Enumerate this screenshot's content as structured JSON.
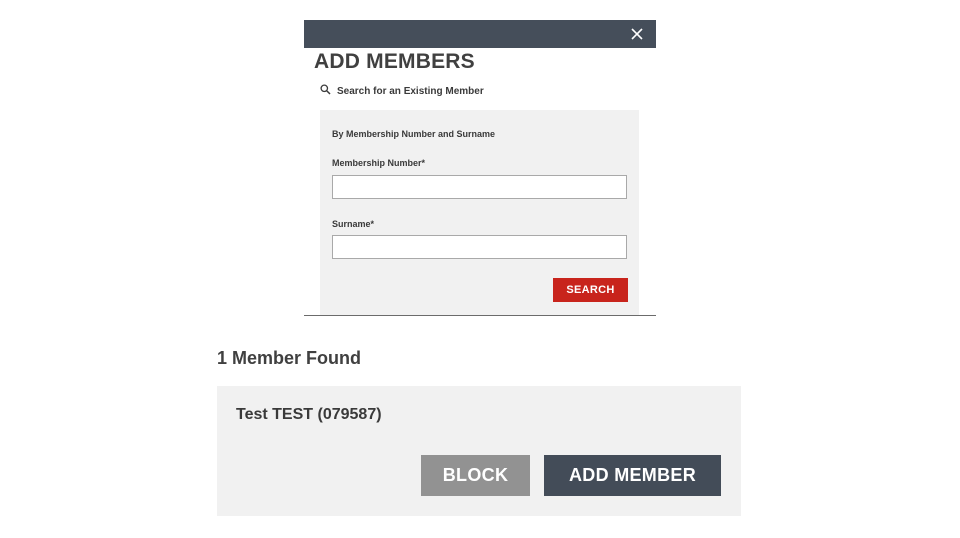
{
  "modal": {
    "title": "ADD MEMBERS",
    "search_toggle_label": "Search for an Existing Member",
    "panel": {
      "subtitle": "By Membership Number and Surname",
      "membership_number": {
        "label": "Membership Number*",
        "value": "",
        "placeholder": ""
      },
      "surname": {
        "label": "Surname*",
        "value": "",
        "placeholder": ""
      },
      "search_button_label": "SEARCH"
    },
    "icons": {
      "close": "close-icon",
      "search": "search-icon"
    }
  },
  "results": {
    "heading": "1 Member Found",
    "members": [
      {
        "name": "Test TEST (079587)",
        "block_label": "BLOCK",
        "add_label": "ADD MEMBER"
      }
    ]
  },
  "colors": {
    "header_bg": "#454e5a",
    "search_button": "#c8241c",
    "block_button": "#929292",
    "add_button": "#434c58",
    "panel_bg": "#f1f1f1"
  }
}
